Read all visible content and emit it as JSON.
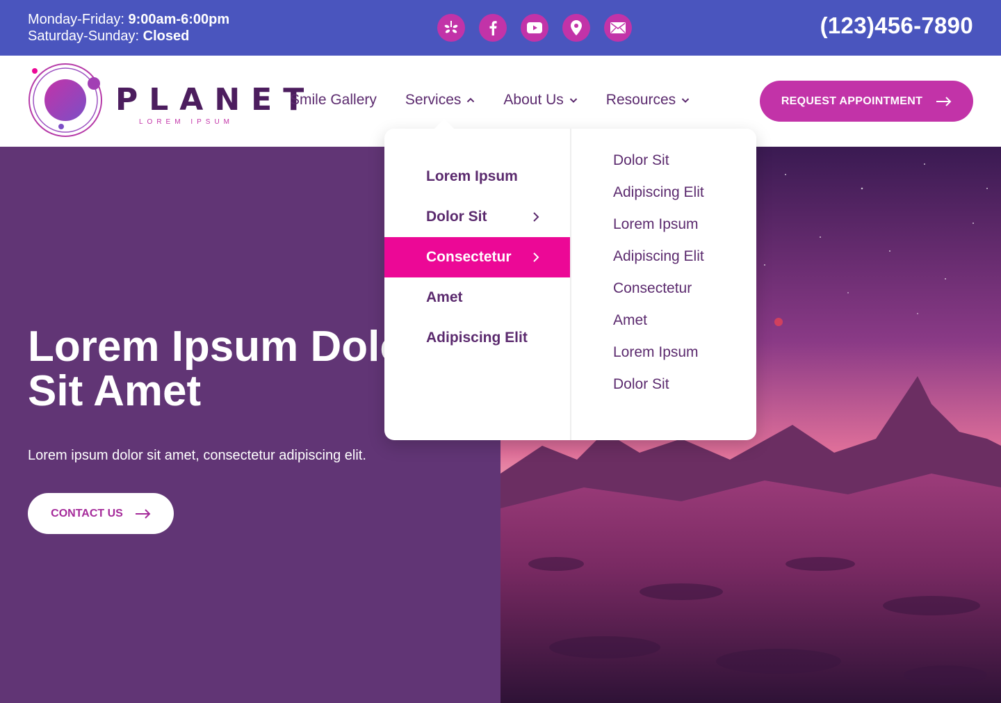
{
  "topbar": {
    "hours": [
      {
        "label": "Monday-Friday: ",
        "value": "9:00am-6:00pm"
      },
      {
        "label": "Saturday-Sunday: ",
        "value": "Closed"
      }
    ],
    "socials": [
      "yelp-icon",
      "facebook-icon",
      "youtube-icon",
      "map-pin-icon",
      "mail-icon"
    ],
    "phone": "(123)456-7890"
  },
  "header": {
    "logo_word": "PLANET",
    "logo_sub": "LOREM IPSUM",
    "nav": [
      {
        "label": "Smile Gallery",
        "has_dropdown": false
      },
      {
        "label": "Services",
        "has_dropdown": true,
        "open": true
      },
      {
        "label": "About Us",
        "has_dropdown": true
      },
      {
        "label": "Resources",
        "has_dropdown": true
      }
    ],
    "cta_label": "REQUEST APPOINTMENT"
  },
  "dropdown": {
    "primary": [
      {
        "label": "Lorem Ipsum",
        "has_sub": false
      },
      {
        "label": "Dolor Sit",
        "has_sub": true
      },
      {
        "label": "Consectetur",
        "has_sub": true,
        "active": true
      },
      {
        "label": "Amet",
        "has_sub": false
      },
      {
        "label": "Adipiscing Elit",
        "has_sub": false
      }
    ],
    "secondary": [
      "Dolor Sit",
      "Adipiscing Elit",
      "Lorem Ipsum",
      "Adipiscing Elit",
      "Consectetur",
      "Amet",
      "Lorem Ipsum",
      "Dolor Sit"
    ]
  },
  "hero": {
    "title_line1": "Lorem Ipsum Dolor",
    "title_line2": "Sit Amet",
    "subtitle": "Lorem ipsum dolor sit amet, consectetur adipiscing elit.",
    "contact_label": "CONTACT US"
  },
  "colors": {
    "topbar": "#4A55BE",
    "accent": "#C233A8",
    "hero_bg": "#613575",
    "active_menu": "#EC0896",
    "text_dark": "#5B2A6E"
  }
}
